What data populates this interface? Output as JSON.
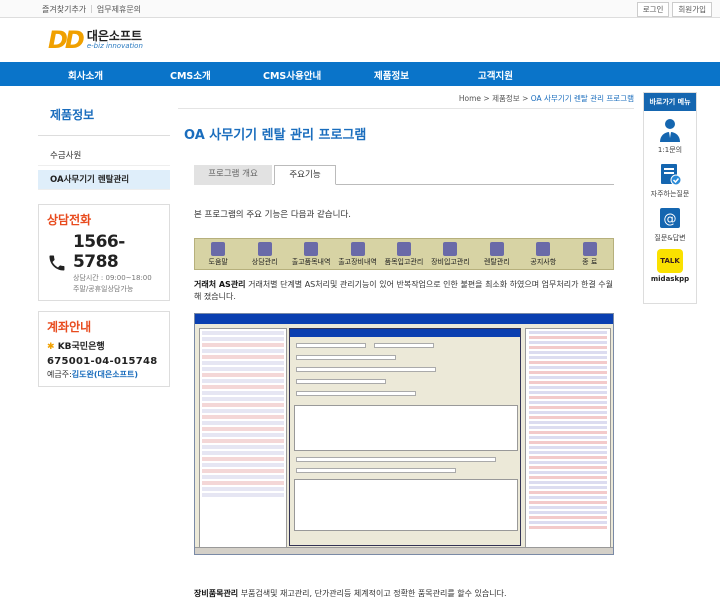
{
  "topbar": {
    "links": [
      "즐겨찾기추가",
      "업무제휴문의"
    ],
    "buttons": [
      "로그인",
      "회원가입"
    ]
  },
  "logo": {
    "mark": "DD",
    "name": "대은소프트",
    "tagline": "e-biz innovation"
  },
  "nav": {
    "items": [
      "회사소개",
      "CMS소개",
      "CMS사용안내",
      "제품정보",
      "고객지원"
    ]
  },
  "sidebar": {
    "title": "제품정보",
    "items": [
      "수금사원",
      "OA사무기기 렌탈관리"
    ],
    "consult": {
      "title": "상담전화",
      "number": "1566-5788",
      "hours": "상담시간 : 09:00~18:00",
      "note": "주말/공휴일상담가능"
    },
    "account": {
      "title": "계좌안내",
      "bank": "KB국민은행",
      "number": "675001-04-015748",
      "holder_label": "예금주:",
      "holder": "김도완(대은소프트)"
    }
  },
  "main": {
    "breadcrumb": [
      "Home",
      "제품정보",
      "OA 사무기기 렌탈 관리 프로그램"
    ],
    "title": "OA 사무기기 렌탈 관리 프로그램",
    "tabs": [
      "프로그램 개요",
      "주요기능"
    ],
    "intro": "본 프로그램의 주요 기능은 다음과 같습니다.",
    "toolbar": [
      "도움말",
      "상담관리",
      "출고품목내역",
      "출고장비내역",
      "품목입고관리",
      "장비입고관리",
      "렌탈관리",
      "공지사항",
      "종 료"
    ],
    "feature1": {
      "title": "거래처 AS관리",
      "text": "거래처별 단계별 AS처리및 관리기능이 있어 반복작업으로 인한 불편을 최소화 하였으며 업무처리가 한결 수월해 졌습니다."
    },
    "feature2": {
      "title": "장비품목관리",
      "text": "부품검색및 재고관리, 단가관리등 체계적이고 정확한 품목관리를 할수 있습니다."
    }
  },
  "quick": {
    "title": "바로가기 메뉴",
    "items": [
      "1:1문의",
      "자주하는질문",
      "질문&답변",
      "midaskpp"
    ],
    "talk_label": "TALK"
  },
  "colors": {
    "brand_blue": "#0a74c9",
    "accent_orange": "#e84b1e",
    "logo_yellow": "#f0a000"
  }
}
